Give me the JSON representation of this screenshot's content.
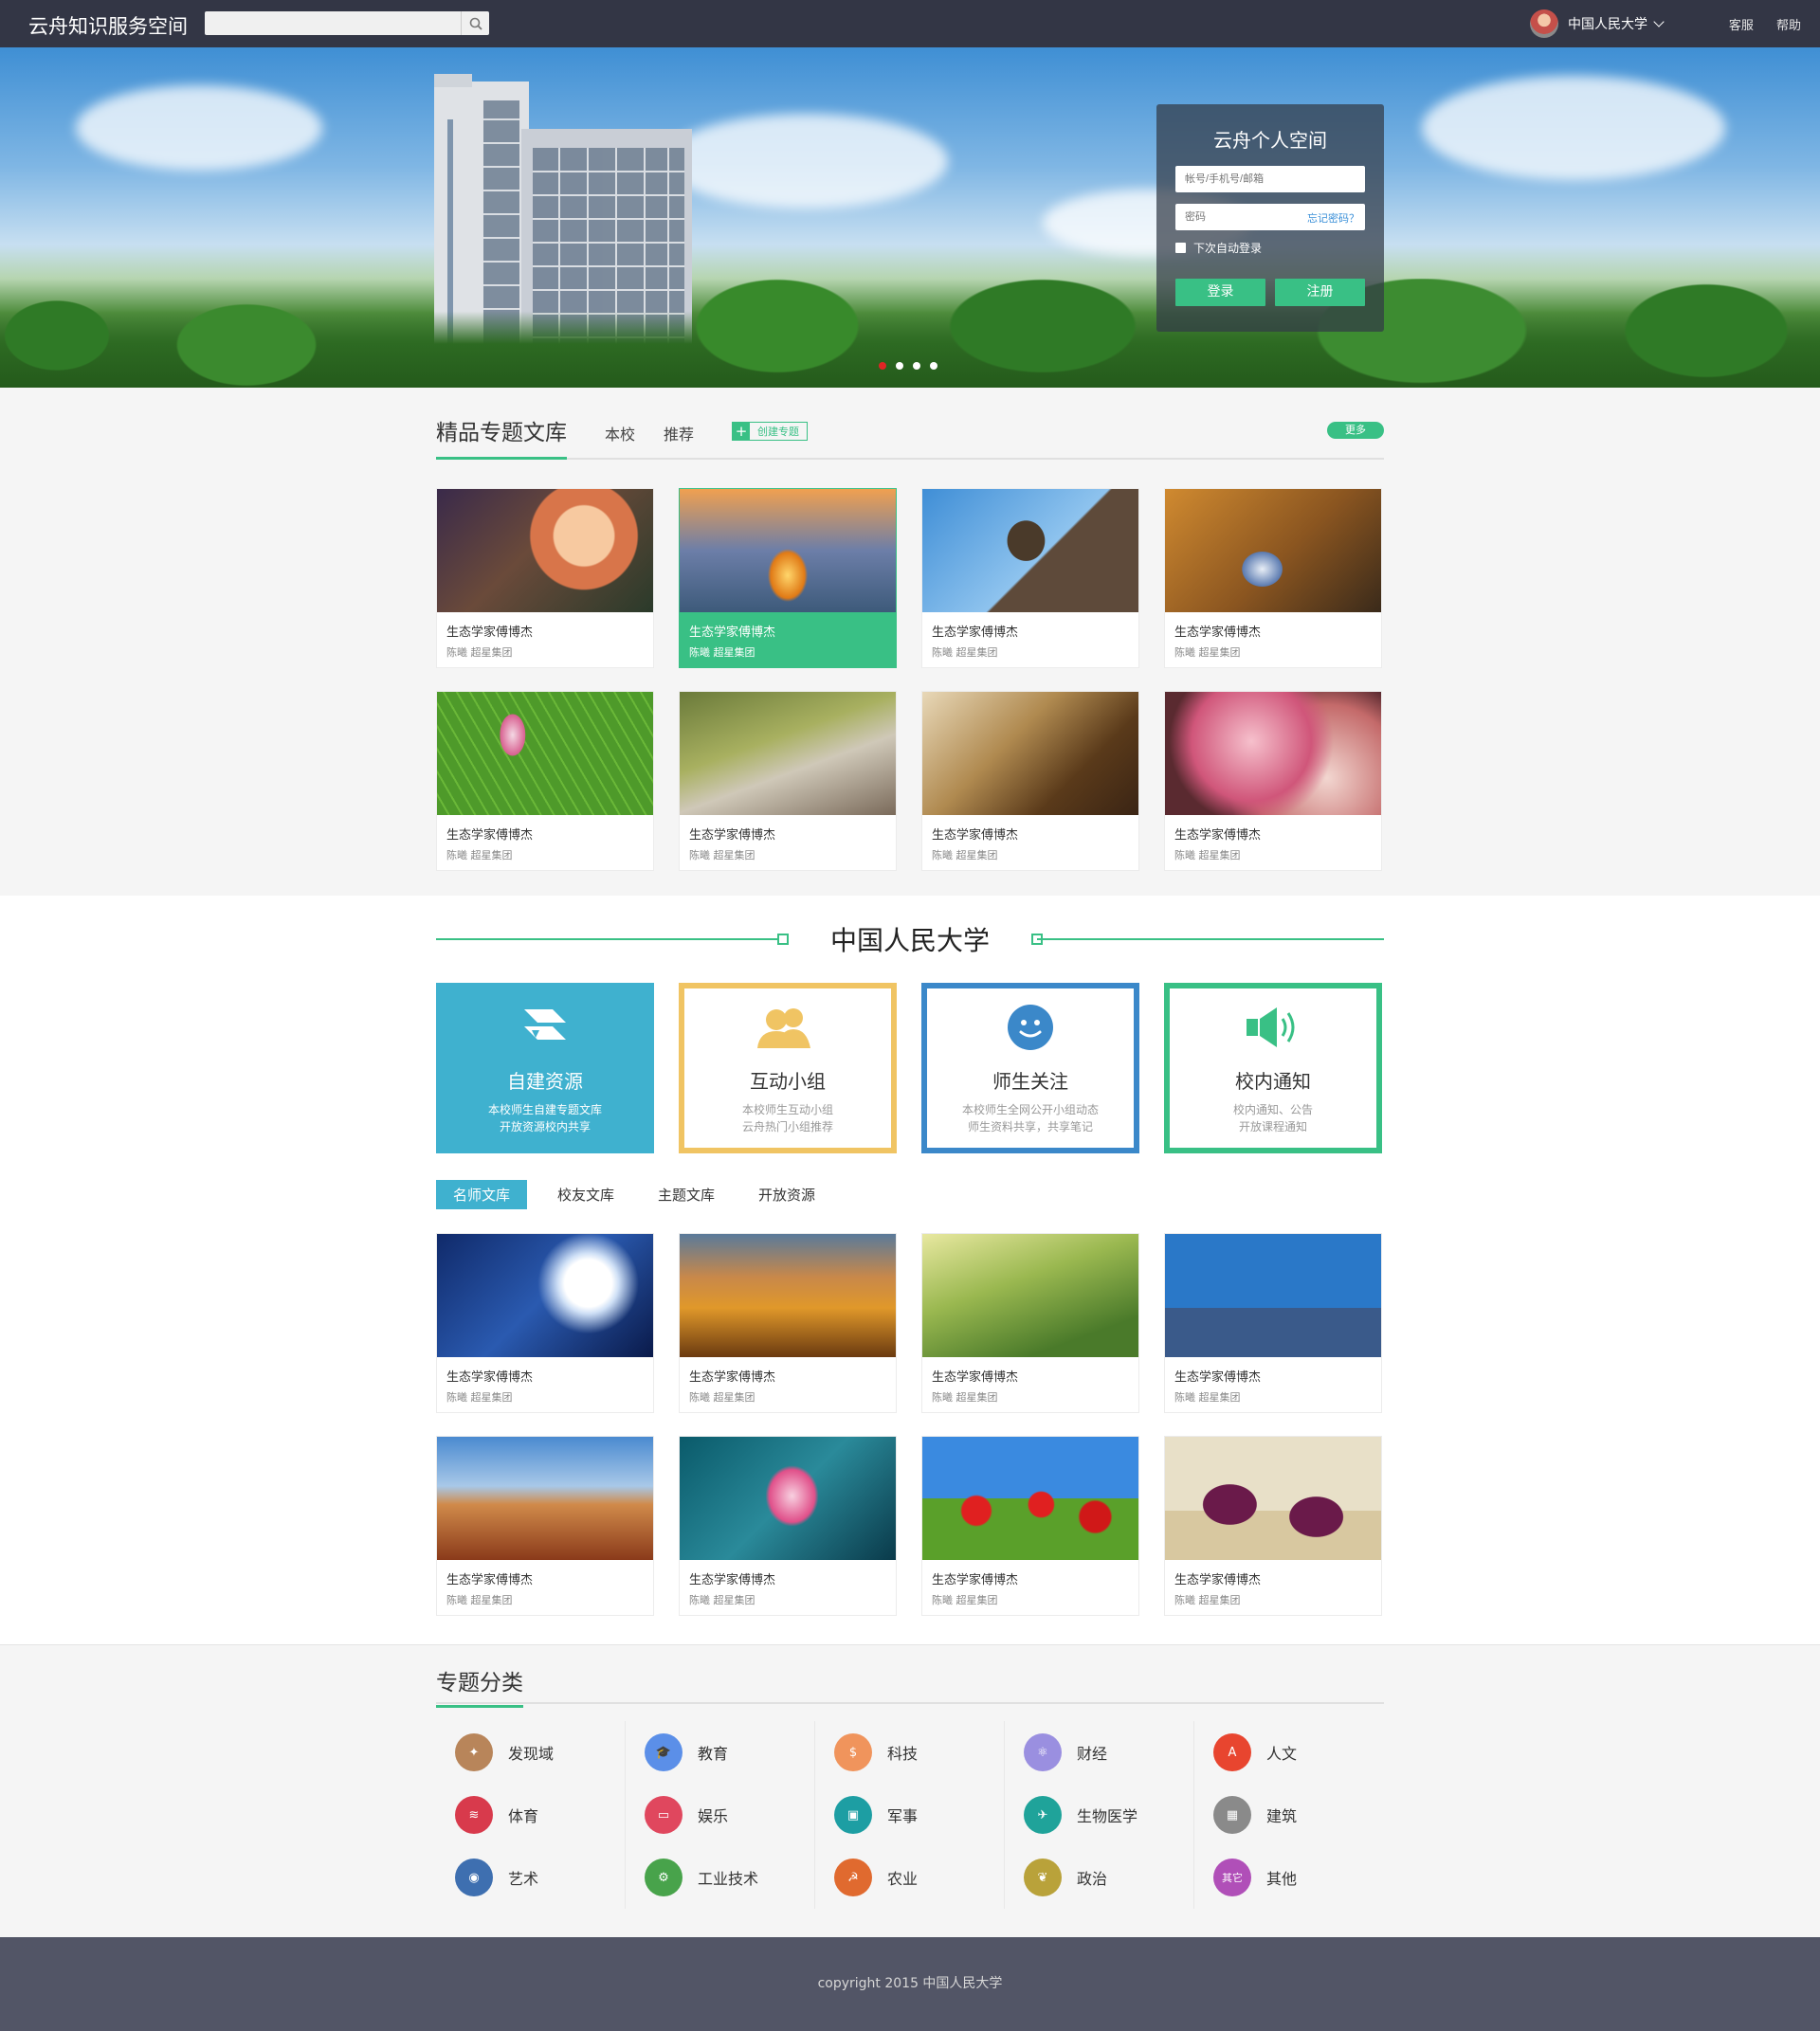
{
  "topbar": {
    "logo": "云舟知识服务空间",
    "search_placeholder": "",
    "school": "中国人民大学",
    "links": [
      "客服",
      "帮助"
    ]
  },
  "login": {
    "title": "云舟个人空间",
    "account_placeholder": "帐号/手机号/邮箱",
    "password_placeholder": "密码",
    "forgot": "忘记密码？",
    "remember": "下次自动登录",
    "login_btn": "登录",
    "register_btn": "注册"
  },
  "section1": {
    "title": "精品专题文库",
    "tabs": [
      "本校",
      "推荐"
    ],
    "create": "创建专题",
    "more": "更多",
    "cards": [
      {
        "title": "生态学家傅博杰",
        "sub": "陈曦  超星集团"
      },
      {
        "title": "生态学家傅博杰",
        "sub": "陈曦  超星集团"
      },
      {
        "title": "生态学家傅博杰",
        "sub": "陈曦  超星集团"
      },
      {
        "title": "生态学家傅博杰",
        "sub": "陈曦  超星集团"
      },
      {
        "title": "生态学家傅博杰",
        "sub": "陈曦  超星集团"
      },
      {
        "title": "生态学家傅博杰",
        "sub": "陈曦  超星集团"
      },
      {
        "title": "生态学家傅博杰",
        "sub": "陈曦  超星集团"
      },
      {
        "title": "生态学家傅博杰",
        "sub": "陈曦  超星集团"
      }
    ]
  },
  "section2": {
    "title": "中国人民大学",
    "features": [
      {
        "name": "自建资源",
        "line1": "本校师生自建专题文库",
        "line2": "开放资源校内共享"
      },
      {
        "name": "互动小组",
        "line1": "本校师生互动小组",
        "line2": "云舟热门小组推荐"
      },
      {
        "name": "师生关注",
        "line1": "本校师生全网公开小组动态",
        "line2": "师生资料共享，共享笔记"
      },
      {
        "name": "校内通知",
        "line1": "校内通知、公告",
        "line2": "开放课程通知"
      }
    ],
    "tabs": [
      "名师文库",
      "校友文库",
      "主题文库",
      "开放资源"
    ],
    "cards": [
      {
        "title": "生态学家傅博杰",
        "sub": "陈曦  超星集团"
      },
      {
        "title": "生态学家傅博杰",
        "sub": "陈曦  超星集团"
      },
      {
        "title": "生态学家傅博杰",
        "sub": "陈曦  超星集团"
      },
      {
        "title": "生态学家傅博杰",
        "sub": "陈曦  超星集团"
      },
      {
        "title": "生态学家傅博杰",
        "sub": "陈曦  超星集团"
      },
      {
        "title": "生态学家傅博杰",
        "sub": "陈曦  超星集团"
      },
      {
        "title": "生态学家傅博杰",
        "sub": "陈曦  超星集团"
      },
      {
        "title": "生态学家傅博杰",
        "sub": "陈曦  超星集团"
      }
    ]
  },
  "section3": {
    "title": "专题分类",
    "categories": [
      {
        "label": "发现域",
        "icon": "compass-icon",
        "color": "#b8855a"
      },
      {
        "label": "教育",
        "icon": "graduation-cap-icon",
        "color": "#5b8fe8"
      },
      {
        "label": "科技",
        "icon": "money-bag-icon",
        "color": "#f0945c"
      },
      {
        "label": "财经",
        "icon": "atom-icon",
        "color": "#9a8fe0"
      },
      {
        "label": "人文",
        "icon": "eiffel-tower-icon",
        "color": "#e8452f"
      },
      {
        "label": "体育",
        "icon": "sneaker-icon",
        "color": "#d83a4c"
      },
      {
        "label": "娱乐",
        "icon": "tv-icon",
        "color": "#e0475e"
      },
      {
        "label": "军事",
        "icon": "briefcase-icon",
        "color": "#1d9ea3"
      },
      {
        "label": "生物医学",
        "icon": "airplane-icon",
        "color": "#1fa39a"
      },
      {
        "label": "建筑",
        "icon": "brick-wall-icon",
        "color": "#8a8a8a"
      },
      {
        "label": "艺术",
        "icon": "palette-icon",
        "color": "#3e6fb0"
      },
      {
        "label": "工业技术",
        "icon": "gears-icon",
        "color": "#48a34b"
      },
      {
        "label": "农业",
        "icon": "hammer-sickle-icon",
        "color": "#e06a2f"
      },
      {
        "label": "政治",
        "icon": "wheat-icon",
        "color": "#b9a23a"
      },
      {
        "label": "其他",
        "icon": "other-icon",
        "color": "#b04fb8",
        "text": "其它"
      }
    ]
  },
  "footer": {
    "copyright": "copyright  2015  中国人民大学"
  },
  "colors": {
    "accent": "#39c085",
    "topbar": "#333645",
    "teal": "#3fb1cf",
    "footer": "#525566"
  }
}
